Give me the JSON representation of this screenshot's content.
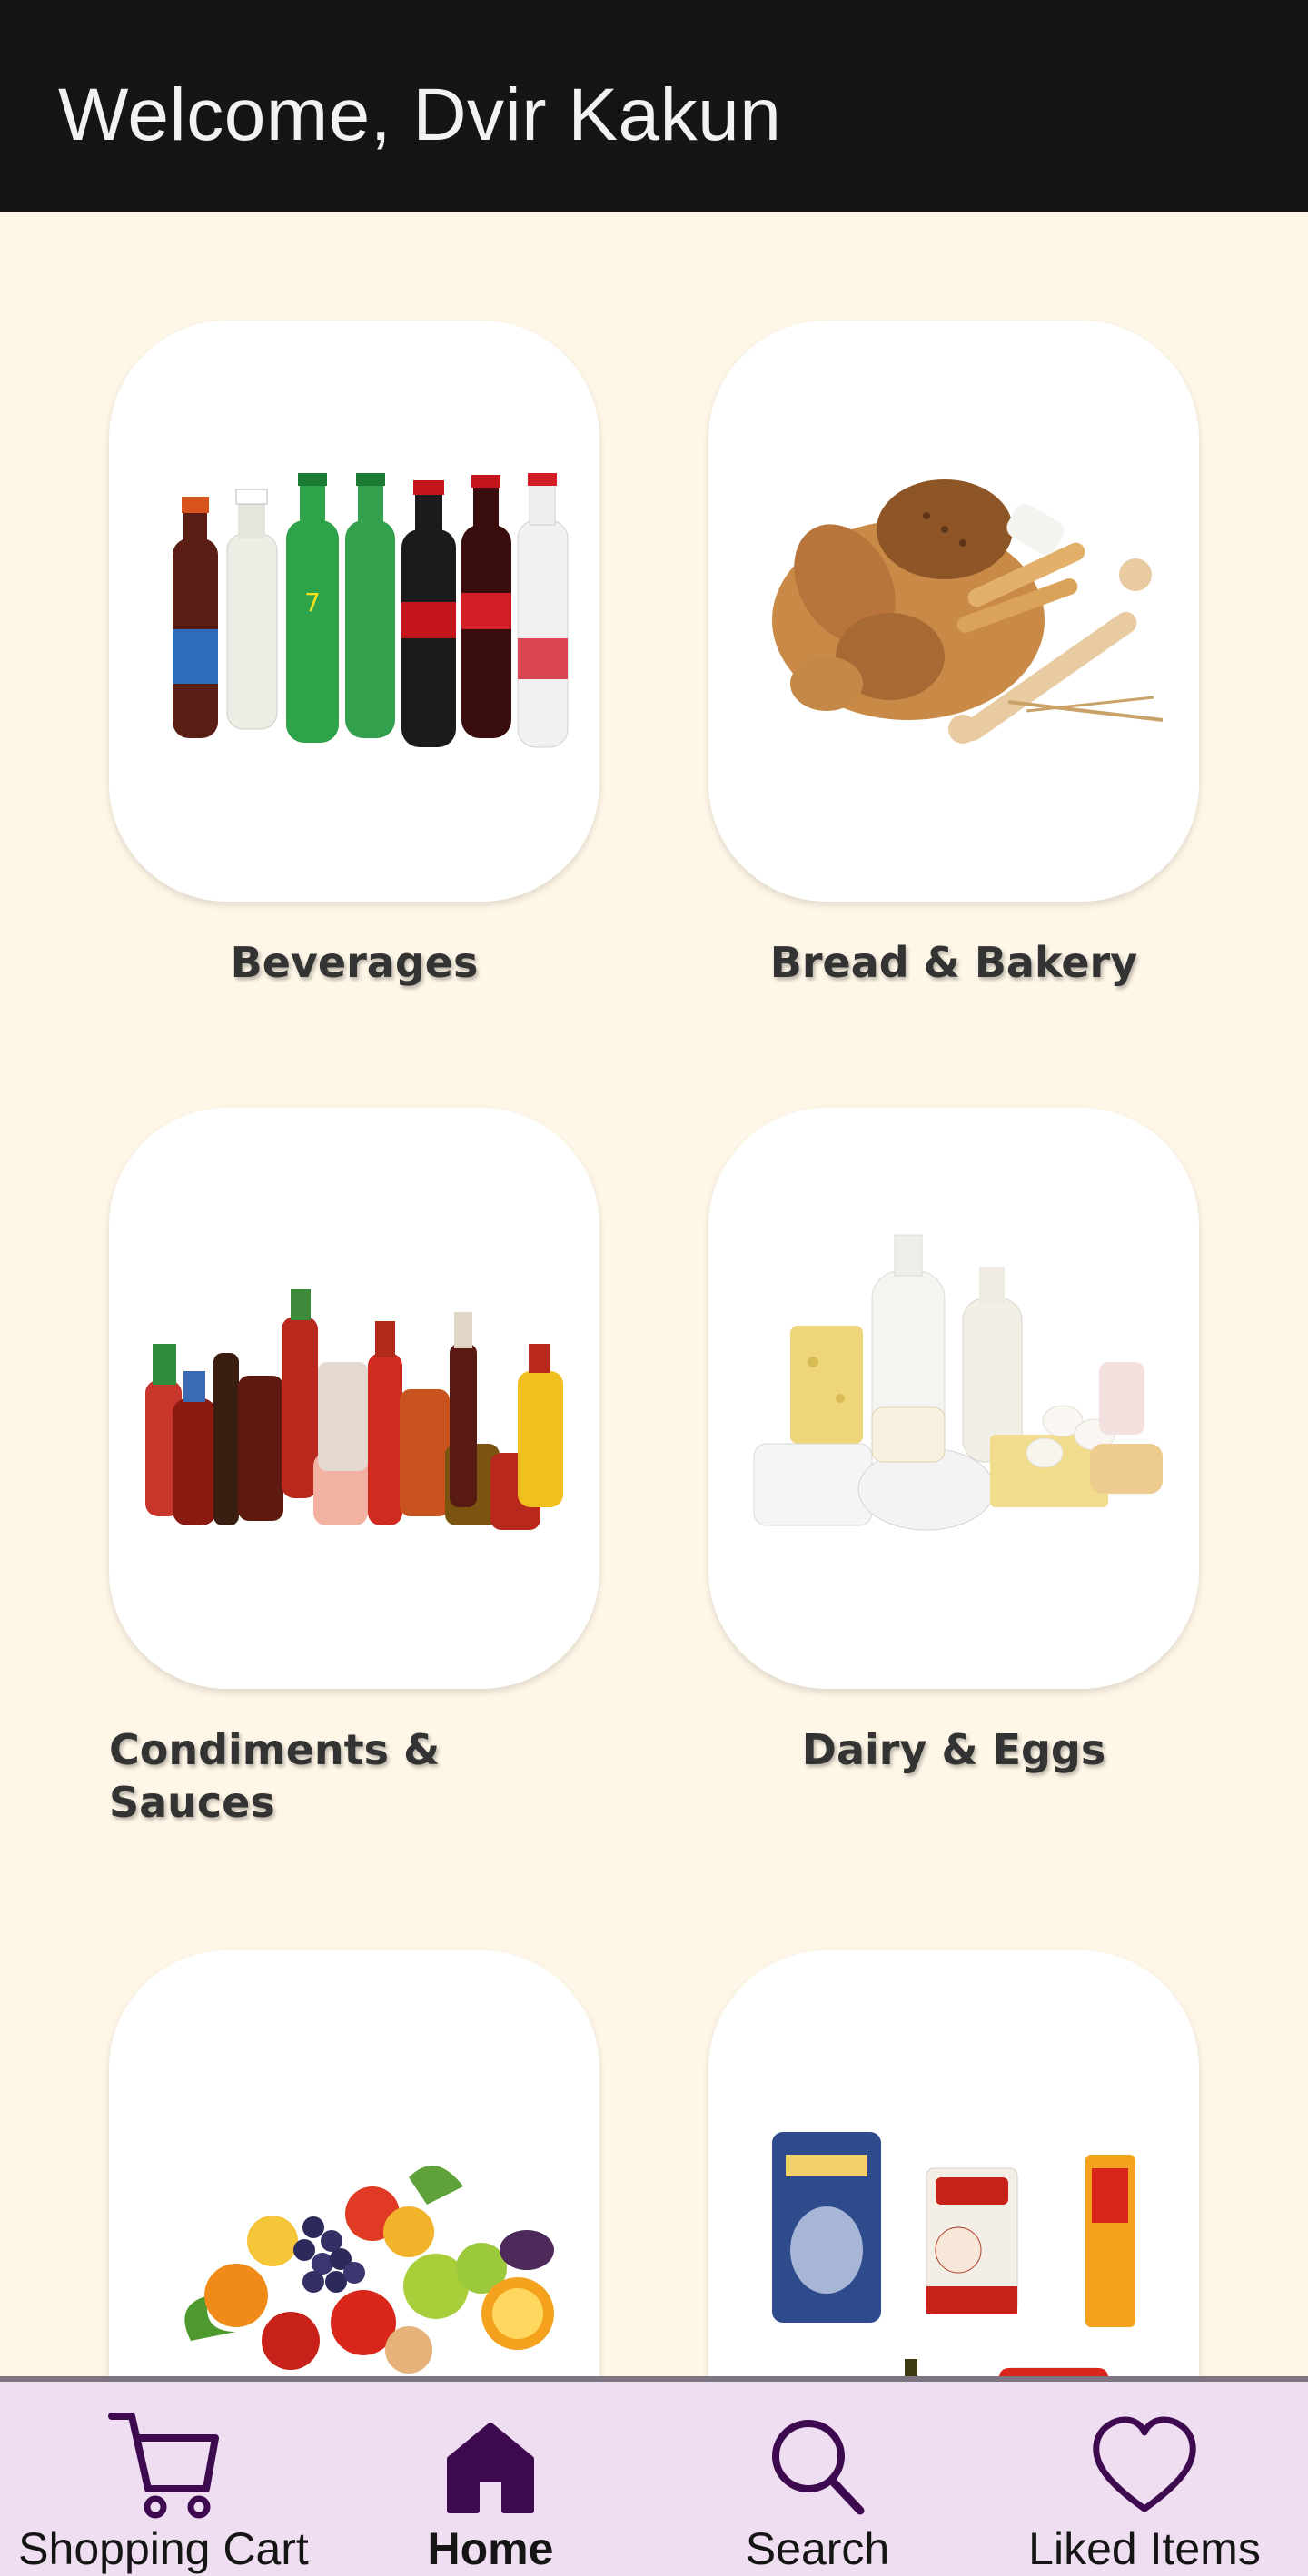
{
  "header": {
    "title": "Welcome, Dvir Kakun"
  },
  "categories": [
    {
      "label": "Beverages",
      "image": "beverages-image"
    },
    {
      "label": "Bread & Bakery",
      "image": "bread-bakery-image"
    },
    {
      "label": "Condiments & Sauces",
      "image": "condiments-sauces-image"
    },
    {
      "label": "Dairy & Eggs",
      "image": "dairy-eggs-image"
    },
    {
      "label": "",
      "image": "fruits-vegetables-image"
    },
    {
      "label": "",
      "image": "pantry-staples-image"
    }
  ],
  "nav": {
    "items": [
      {
        "label": "Shopping Cart",
        "icon": "cart-icon",
        "active": false
      },
      {
        "label": "Home",
        "icon": "home-icon",
        "active": true
      },
      {
        "label": "Search",
        "icon": "search-icon",
        "active": false
      },
      {
        "label": "Liked Items",
        "icon": "heart-icon",
        "active": false
      }
    ]
  },
  "colors": {
    "header_bg": "#151515",
    "page_bg": "#FEF6E6",
    "nav_bg": "#EFDDF1",
    "accent": "#3D0A4F"
  }
}
